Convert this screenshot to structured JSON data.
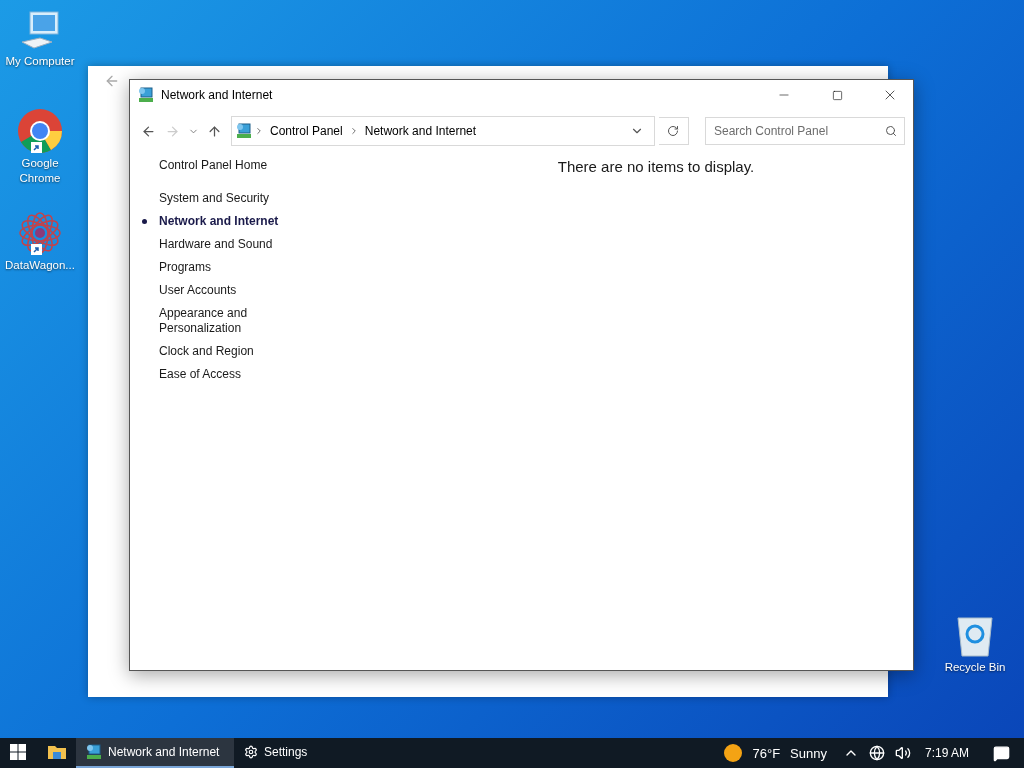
{
  "desktop_icons": [
    {
      "kind": "computer",
      "label": "My Computer",
      "shortcut": false
    },
    {
      "kind": "chrome",
      "label": "Google Chrome",
      "shortcut": true
    },
    {
      "kind": "datawagon",
      "label": "DataWagon...",
      "shortcut": true
    },
    {
      "kind": "recycle",
      "label": "Recycle Bin",
      "shortcut": false
    }
  ],
  "window": {
    "title": "Network and Internet",
    "breadcrumb": [
      "Control Panel",
      "Network and Internet"
    ],
    "search": {
      "placeholder": "Search Control Panel"
    },
    "sidebar": {
      "home": "Control Panel Home",
      "items": [
        {
          "label": "System and Security",
          "selected": false
        },
        {
          "label": "Network and Internet",
          "selected": true
        },
        {
          "label": "Hardware and Sound",
          "selected": false
        },
        {
          "label": "Programs",
          "selected": false
        },
        {
          "label": "User Accounts",
          "selected": false
        },
        {
          "label": "Appearance and Personalization",
          "selected": false
        },
        {
          "label": "Clock and Region",
          "selected": false
        },
        {
          "label": "Ease of Access",
          "selected": false
        }
      ]
    },
    "empty_message": "There are no items to display."
  },
  "taskbar": {
    "apps": [
      {
        "kind": "network",
        "label": "Network and Internet",
        "selected": true
      },
      {
        "kind": "settings",
        "label": "Settings",
        "selected": false
      }
    ],
    "weather": {
      "temperature": "76°F",
      "condition": "Sunny"
    },
    "time": "7:19 AM"
  }
}
